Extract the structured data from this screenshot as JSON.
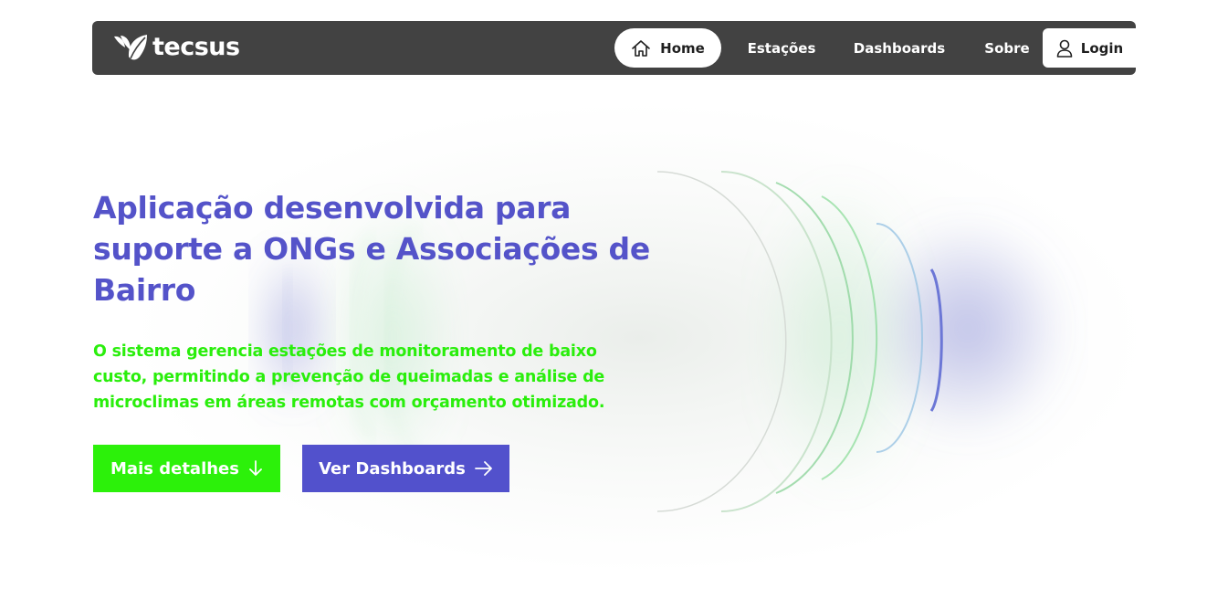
{
  "brand": {
    "name": "tecsus",
    "logo_icon": "leaf-icon"
  },
  "nav": {
    "home": "Home",
    "stations": "Estações",
    "dashboards": "Dashboards",
    "about": "Sobre",
    "login": "Login"
  },
  "hero": {
    "title": "Aplicação desenvolvida para suporte a ONGs e Associações de Bairro",
    "description": "O sistema gerencia estações de monitoramento de baixo custo, permitindo a prevenção de queimadas e análise de microclimas em áreas remotas com orçamento otimizado.",
    "primary_button": "Mais detalhes",
    "secondary_button": "Ver Dashboards"
  },
  "colors": {
    "navbar": "#424242",
    "accent_purple": "#5453c9",
    "accent_green": "#2cf10a"
  },
  "icons": {
    "home": "home-icon",
    "login": "user-icon",
    "primary_button": "arrow-down-icon",
    "secondary_button": "arrow-right-icon"
  }
}
